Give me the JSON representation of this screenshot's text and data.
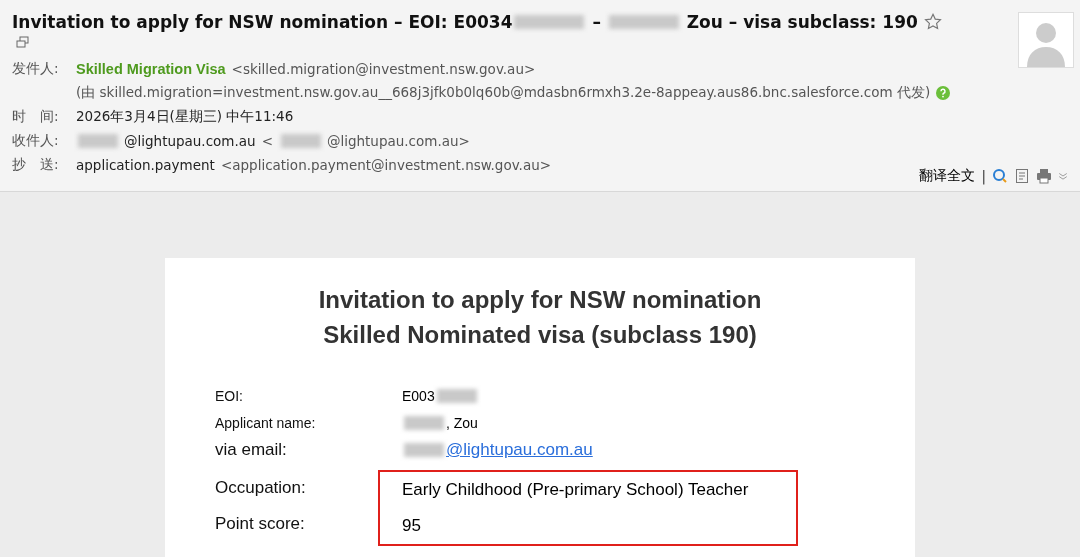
{
  "email": {
    "title": [
      {
        "kind": "text",
        "text": "Invitation to apply for NSW nomination – EOI: E0034"
      },
      {
        "kind": "redacted"
      },
      {
        "kind": "text",
        "text": " – "
      },
      {
        "kind": "redacted"
      },
      {
        "kind": "text",
        "text": " Zou – visa subclass: 190"
      }
    ],
    "starred": false,
    "headers": [
      {
        "label": "发件人:",
        "parts": [
          {
            "kind": "name",
            "text": "Skilled Migration Visa"
          },
          {
            "kind": "address",
            "text": "<skilled.migration@investment.nsw.gov.au>"
          }
        ]
      },
      {
        "parts": [
          {
            "kind": "address",
            "text": "(由 skilled.migration=investment.nsw.gov.au__668j3jfk0b0lq60b@mdasbn6rmxh3.2e-8appeay.aus86.bnc.salesforce.com 代发)"
          },
          {
            "kind": "help"
          }
        ]
      },
      {
        "label": "时　间:",
        "parts": [
          {
            "kind": "text",
            "text": "2026年3月4日(星期三) 中午11:46"
          }
        ]
      },
      {
        "label": "收件人:",
        "parts": [
          {
            "kind": "redacted"
          },
          {
            "kind": "text",
            "text": "@lightupau.com.au"
          },
          {
            "kind": "address",
            "text": "<"
          },
          {
            "kind": "redacted"
          },
          {
            "kind": "address",
            "text": "@lightupau.com.au>"
          }
        ]
      },
      {
        "label": "抄　送:",
        "parts": [
          {
            "kind": "text",
            "text": "application.payment"
          },
          {
            "kind": "address",
            "text": "<application.payment@investment.nsw.gov.au>"
          }
        ]
      }
    ],
    "translate": "翻译全文",
    "separator": "|"
  },
  "letter": {
    "heading": [
      "Invitation to apply for NSW nomination",
      "Skilled Nominated visa (subclass 190)"
    ],
    "details": [
      {
        "kind": "small",
        "label": "EOI:",
        "parts": [
          {
            "kind": "text",
            "text": "E003"
          },
          {
            "kind": "redacted"
          }
        ]
      },
      {
        "kind": "small",
        "label": "Applicant name:",
        "parts": [
          {
            "kind": "redacted"
          },
          {
            "kind": "text",
            "text": ", Zou"
          }
        ]
      },
      {
        "kind": "large",
        "label": "via email:",
        "parts": [
          {
            "kind": "redacted"
          },
          {
            "kind": "link",
            "text": "@lightupau.com.au"
          }
        ]
      }
    ],
    "highlighted_details": [
      {
        "label": "Occupation:",
        "parts": [
          {
            "kind": "text",
            "text": "Early Childhood (Pre-primary School) Teacher"
          }
        ]
      },
      {
        "label": "Point score:",
        "parts": [
          {
            "kind": "text",
            "text": "95"
          }
        ]
      }
    ]
  }
}
